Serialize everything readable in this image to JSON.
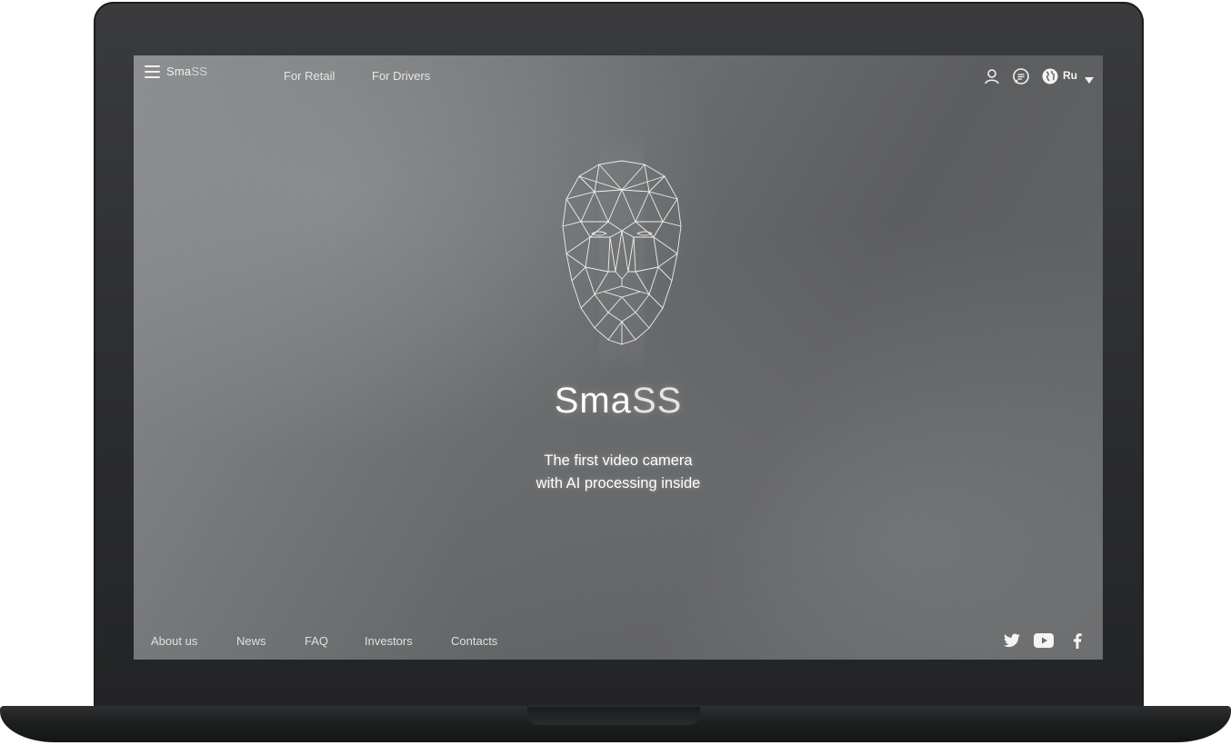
{
  "header": {
    "brand": {
      "bold": "Sma",
      "light": "SS"
    },
    "nav": [
      {
        "label": "For Retail"
      },
      {
        "label": "For Drivers"
      }
    ],
    "language": "Ru",
    "icons": [
      "user-icon",
      "chat-icon",
      "globe-icon",
      "caret-down-icon"
    ]
  },
  "hero": {
    "title": {
      "bold": "Sma",
      "light": "SS"
    },
    "subtitle_line1": "The first video camera",
    "subtitle_line2": "with AI processing inside"
  },
  "footer": {
    "links": [
      {
        "label": "About us"
      },
      {
        "label": "News"
      },
      {
        "label": "FAQ"
      },
      {
        "label": "Investors"
      },
      {
        "label": "Contacts"
      }
    ],
    "social": [
      "twitter-icon",
      "youtube-icon",
      "facebook-icon"
    ]
  },
  "colors": {
    "bezel": "#2b2c2e",
    "screen_bg": "#6e7072",
    "text": "#ffffff"
  }
}
